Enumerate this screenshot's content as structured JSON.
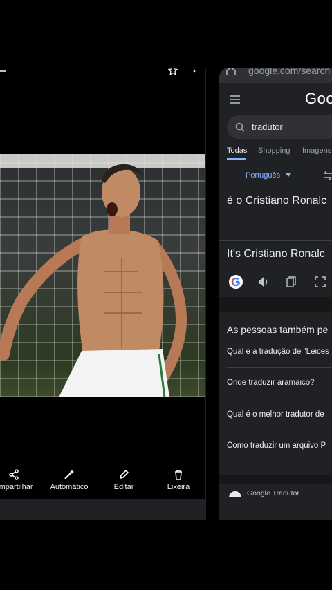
{
  "left_panel": {
    "toolbar": [
      {
        "label": "ompartilhar",
        "icon": "share-icon"
      },
      {
        "label": "Automático",
        "icon": "magic-wand-icon"
      },
      {
        "label": "Editar",
        "icon": "edit-icon"
      },
      {
        "label": "Lixeira",
        "icon": "trash-icon"
      }
    ]
  },
  "right_panel": {
    "url": "google.com/search",
    "logo": "Goo",
    "search_query": "tradutor",
    "tabs": [
      "Todas",
      "Shopping",
      "Imagens"
    ],
    "language": "Português",
    "source_text": "é o Cristiano Ronalc",
    "translated_text": "It's Cristiano Ronalc",
    "people_also_ask": "As pessoas também pe",
    "questions": [
      "Qual é a tradução de \"Leices",
      "Onde traduzir aramaico?",
      "Qual é o melhor tradutor de",
      "Como traduzir um arquivo P"
    ],
    "footer_source": "Google Tradutor"
  },
  "colors": {
    "background": "#000000",
    "google_bg": "#202124",
    "link_blue": "#8ab4f8",
    "text": "#e8eaed"
  }
}
